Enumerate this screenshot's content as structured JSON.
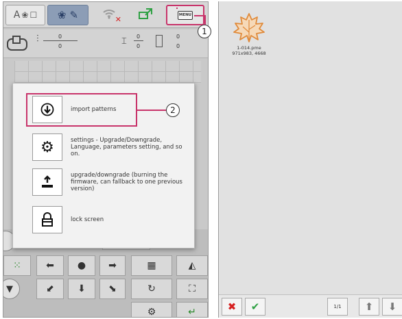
{
  "toolbar": {
    "menu_button_label": "MENU"
  },
  "status": {
    "needle_top": "0",
    "needle_bottom": "0",
    "spool_top": "0",
    "spool_bottom": "0",
    "right_top": "0",
    "right_bottom": "0"
  },
  "menu": {
    "items": [
      {
        "label": "import patterns",
        "icon": "download-circle-icon"
      },
      {
        "label": "settings - Upgrade/Downgrade, Language, parameters setting, and so on.",
        "icon": "gear-icon"
      },
      {
        "label": "upgrade/downgrade (burning the firmware, can fallback to one previous version)",
        "icon": "upload-icon"
      },
      {
        "label": "lock screen",
        "icon": "lock-icon"
      }
    ]
  },
  "callouts": {
    "one": "1",
    "two": "2"
  },
  "file_browser": {
    "pattern": {
      "name": "1-014.pme",
      "meta": "971x983, 4668",
      "color": "#e08a3a"
    },
    "page_indicator": "1/1"
  },
  "colors": {
    "highlight": "#c8336a",
    "cancel": "#d62020",
    "confirm": "#2ea043"
  }
}
